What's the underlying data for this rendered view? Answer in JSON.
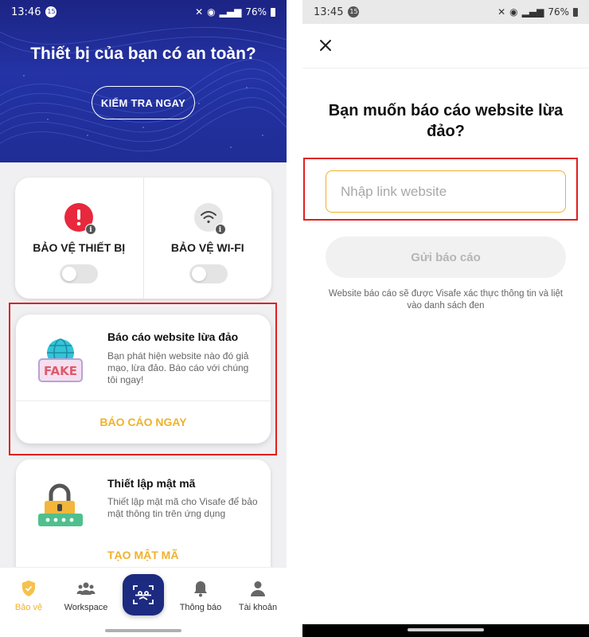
{
  "left_screen": {
    "status_bar": {
      "time": "13:46",
      "badge": "15",
      "battery": "76%"
    },
    "hero": {
      "title": "Thiết bị của bạn có an toàn?",
      "button_label": "KIỂM TRA NGAY"
    },
    "protection": {
      "device": {
        "label": "BẢO VỆ THIẾT BỊ",
        "icon": "alert-icon",
        "color": "#e8283c",
        "enabled": false
      },
      "wifi": {
        "label": "BẢO VỆ WI-FI",
        "icon": "wifi-icon",
        "enabled": false
      }
    },
    "report_card": {
      "title": "Báo cáo website lừa đảo",
      "description": "Bạn phát hiện website nào đó giả mạo, lừa đảo. Báo cáo với chúng tôi ngay!",
      "image_text": "FAKE",
      "action": "BÁO CÁO NGAY"
    },
    "password_card": {
      "title": "Thiết lập mật mã",
      "description": "Thiết lập mật mã cho Visafe để bảo mật thông tin trên ứng dụng",
      "action": "TẠO MẬT MÃ"
    },
    "bottom_nav": {
      "items": [
        {
          "label": "Bảo vệ",
          "icon": "shield-icon",
          "active": true
        },
        {
          "label": "Workspace",
          "icon": "group-icon",
          "active": false
        },
        {
          "label": "",
          "icon": "scan-icon",
          "active": false
        },
        {
          "label": "Thông báo",
          "icon": "bell-icon",
          "active": false
        },
        {
          "label": "Tài khoản",
          "icon": "user-icon",
          "active": false
        }
      ]
    }
  },
  "right_screen": {
    "status_bar": {
      "time": "13:45",
      "badge": "15",
      "battery": "76%"
    },
    "title": "Bạn muốn báo cáo website lừa đảo?",
    "input": {
      "placeholder": "Nhập link website",
      "value": ""
    },
    "submit_label": "Gửi báo cáo",
    "note": "Website báo cáo sẽ được Visafe xác thực thông tin và liệt vào danh sách đen"
  },
  "colors": {
    "accent": "#f0b12a",
    "brand_blue": "#1c2a80",
    "highlight_red": "#e02020",
    "alert_red": "#e8283c"
  }
}
